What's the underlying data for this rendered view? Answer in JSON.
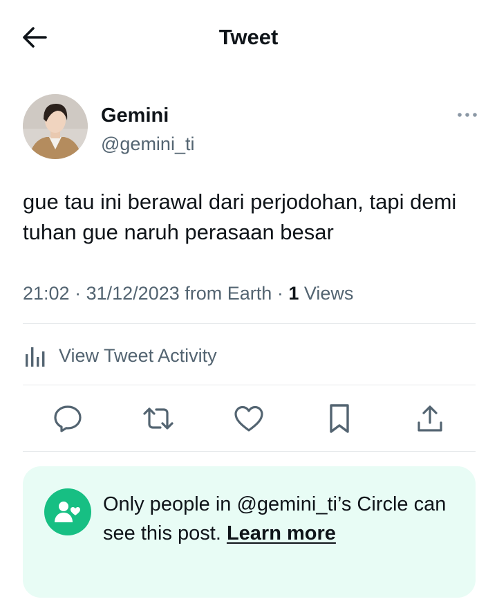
{
  "header": {
    "title": "Tweet"
  },
  "user": {
    "name": "Gemini",
    "handle": "@gemini_ti"
  },
  "tweet": {
    "text": "gue tau ini berawal dari perjodohan, tapi demi tuhan gue naruh perasaan besar",
    "time": "21:02",
    "separator": "·",
    "date": "31/12/2023",
    "source": "from Earth",
    "views_count": "1",
    "views_label": "Views"
  },
  "activity": {
    "label": "View Tweet Activity"
  },
  "actions": [
    "reply-icon",
    "retweet-icon",
    "like-icon",
    "bookmark-icon",
    "share-icon"
  ],
  "circle": {
    "text": "Only people in @gemini_ti’s Circle can see this post.",
    "link": "Learn more"
  },
  "colors": {
    "text": "#0f1419",
    "secondary": "#536471",
    "circle_bg": "#e8fcf5",
    "circle_accent": "#17bf83"
  }
}
